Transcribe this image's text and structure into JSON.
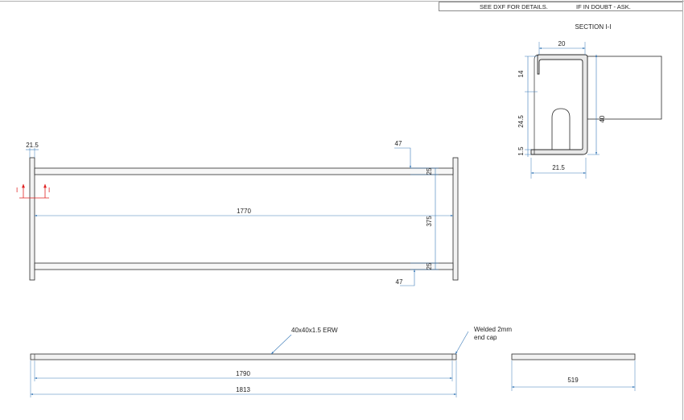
{
  "title_block": {
    "note_dxf": "SEE DXF FOR DETAILS.",
    "note_doubt": "IF IN DOUBT - ASK."
  },
  "section": {
    "title": "SECTION I-I",
    "marker_left": "I",
    "marker_right": "I",
    "dim_width_top": "20",
    "dim_height_14": "14",
    "dim_height_245": "24.5",
    "dim_height_15": "1.5",
    "dim_height_40": "40",
    "dim_width_bottom": "21.5"
  },
  "plan_view": {
    "dim_215": "21.5",
    "dim_47_top": "47",
    "dim_25_top": "25",
    "dim_1770": "1770",
    "dim_375": "375",
    "dim_25_bottom": "25",
    "dim_47_bottom": "47"
  },
  "elevation_view": {
    "label_tube": "40x40x1.5 ERW",
    "label_cap_line1": "Welded 2mm",
    "label_cap_line2": "end cap",
    "dim_1790": "1790",
    "dim_1813": "1813"
  },
  "end_view": {
    "dim_519": "519"
  },
  "colors": {
    "line": "#2a2a2a",
    "dimension": "#3a7ab8",
    "section_marker": "#e02020"
  }
}
